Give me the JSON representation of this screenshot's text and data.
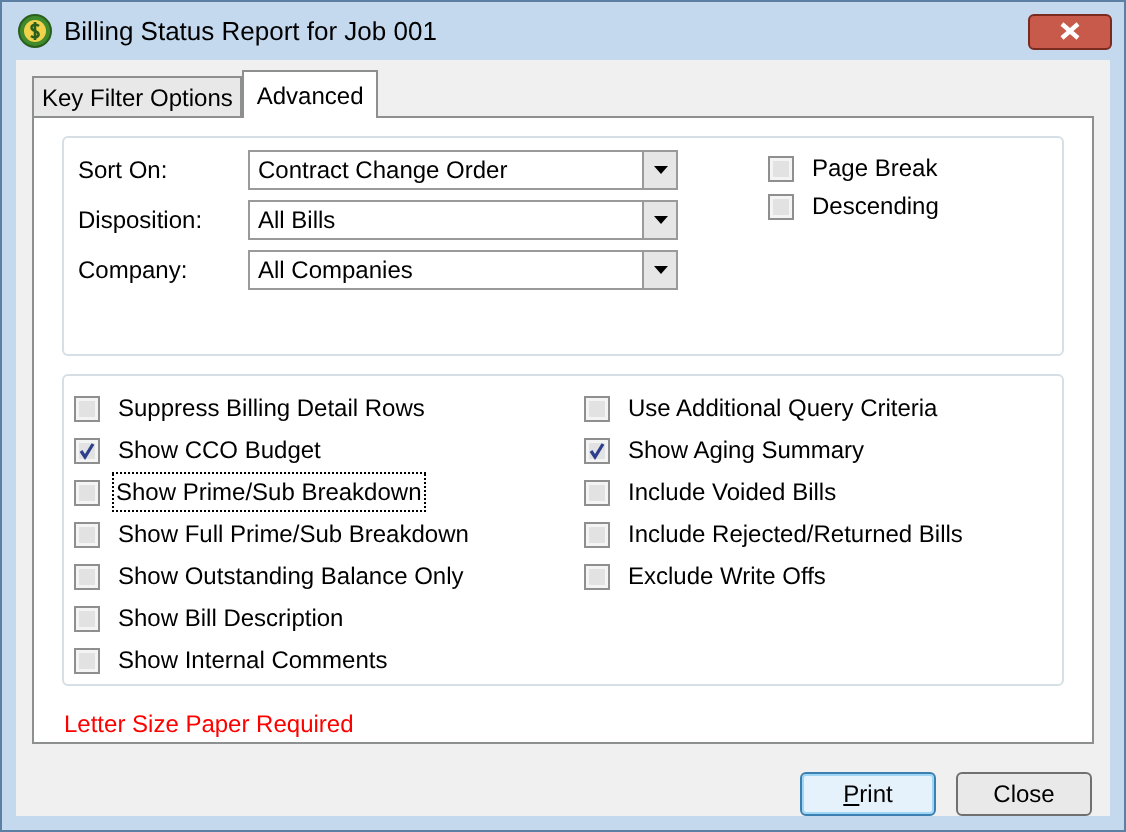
{
  "window": {
    "title": "Billing Status Report for Job 001"
  },
  "tabs": [
    {
      "label": "Key Filter Options",
      "selected": false
    },
    {
      "label": "Advanced",
      "selected": true
    }
  ],
  "dropdowns": [
    {
      "label": "Sort On:",
      "value": "Contract Change Order"
    },
    {
      "label": "Disposition:",
      "value": "All Bills"
    },
    {
      "label": "Company:",
      "value": "All Companies"
    }
  ],
  "sort_options": [
    {
      "label": "Page Break",
      "checked": false
    },
    {
      "label": "Descending",
      "checked": false
    }
  ],
  "options_left": [
    {
      "label": "Suppress Billing Detail Rows",
      "checked": false,
      "focused": false
    },
    {
      "label": "Show CCO Budget",
      "checked": true,
      "focused": false
    },
    {
      "label": "Show Prime/Sub Breakdown",
      "checked": false,
      "focused": true
    },
    {
      "label": "Show Full Prime/Sub Breakdown",
      "checked": false,
      "focused": false
    },
    {
      "label": "Show Outstanding Balance Only",
      "checked": false,
      "focused": false
    },
    {
      "label": "Show Bill Description",
      "checked": false,
      "focused": false
    },
    {
      "label": "Show Internal Comments",
      "checked": false,
      "focused": false
    }
  ],
  "options_right": [
    {
      "label": "Use Additional Query Criteria",
      "checked": false,
      "focused": false
    },
    {
      "label": "Show Aging Summary",
      "checked": true,
      "focused": false
    },
    {
      "label": "Include Voided Bills",
      "checked": false,
      "focused": false
    },
    {
      "label": "Include Rejected/Returned Bills",
      "checked": false,
      "focused": false
    },
    {
      "label": "Exclude Write Offs",
      "checked": false,
      "focused": false
    }
  ],
  "notice": "Letter Size Paper Required",
  "buttons": [
    {
      "label": "Print",
      "default": true
    },
    {
      "label": "Close",
      "default": false
    }
  ]
}
